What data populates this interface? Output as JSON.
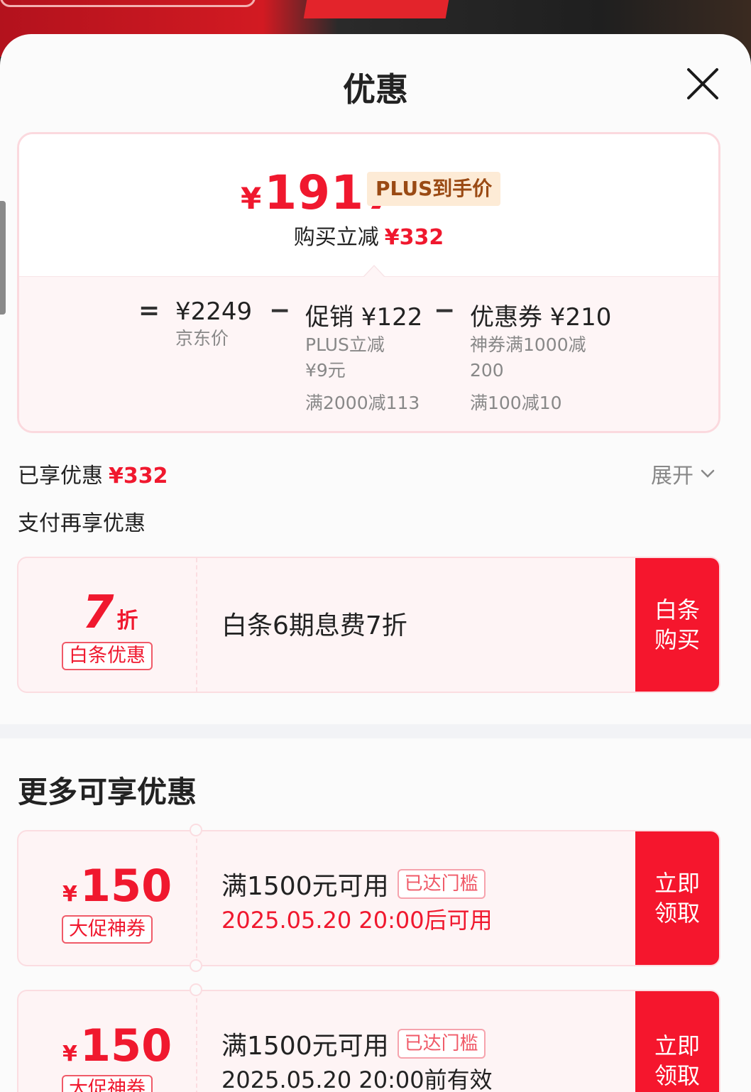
{
  "sheet": {
    "title": "优惠"
  },
  "price": {
    "currency": "¥",
    "final": "1917",
    "badge": "PLUS到手价",
    "reduce_label": "购买立减",
    "reduce_amount": "¥332",
    "eq": "=",
    "minus": "−",
    "jd_price": {
      "value": "¥2249",
      "label": "京东价"
    },
    "promo": {
      "value": "促销 ¥122",
      "line1": "PLUS立减",
      "line2": "¥9元",
      "line3": "满2000减113"
    },
    "coupon": {
      "value": "优惠券 ¥210",
      "line1": "神券满1000减",
      "line2": "200",
      "line3": "满100减10"
    }
  },
  "enjoyed": {
    "label": "已享优惠",
    "amount": "¥332",
    "expand": "展开"
  },
  "pay_section": {
    "title": "支付再享优惠"
  },
  "baitiao_coupon": {
    "discount": "7",
    "discount_unit": "折",
    "tag": "白条优惠",
    "desc": "白条6期息费7折",
    "action": "白条购买"
  },
  "more_section": {
    "title": "更多可享优惠"
  },
  "coupons": [
    {
      "currency": "¥",
      "amount": "150",
      "tag": "大促神券",
      "condition": "满1500元可用",
      "status": "已达门槛",
      "time": "2025.05.20 20:00后可用",
      "action": "立即领取"
    },
    {
      "currency": "¥",
      "amount": "150",
      "tag": "大促神券",
      "condition": "满1500元可用",
      "status": "已达门槛",
      "time": "2025.05.20 20:00前有效",
      "action": "立即领取"
    }
  ],
  "colors": {
    "accent": "#f0182e",
    "button": "#f5162d",
    "badge_bg": "#fdebd6",
    "badge_text": "#9a4a14"
  }
}
